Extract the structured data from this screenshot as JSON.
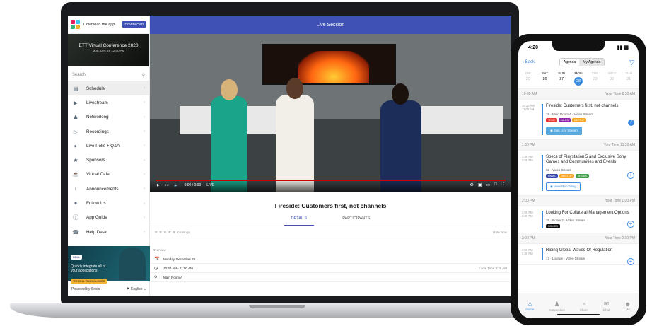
{
  "laptop": {
    "sidebar": {
      "download_text": "Download the app",
      "download_button": "DOWNLOAD",
      "event_title": "ETT Virtual Conference 2020",
      "event_date": "Mon, Dec 28 12:00 AM",
      "search_placeholder": "Search",
      "items": [
        {
          "label": "Schedule",
          "icon": "calendar-icon"
        },
        {
          "label": "Livestream",
          "icon": "video-icon"
        },
        {
          "label": "Networking",
          "icon": "people-icon"
        },
        {
          "label": "Recordings",
          "icon": "play-icon"
        },
        {
          "label": "Live Polls + Q&A",
          "icon": "poll-icon"
        },
        {
          "label": "Sponsors",
          "icon": "trophy-icon"
        },
        {
          "label": "Virtual Cafe",
          "icon": "cafe-icon"
        },
        {
          "label": "Announcements",
          "icon": "megaphone-icon"
        },
        {
          "label": "Follow Us",
          "icon": "twitter-icon"
        },
        {
          "label": "App Guide",
          "icon": "info-icon"
        },
        {
          "label": "Help Desk",
          "icon": "help-icon"
        }
      ],
      "ad": {
        "brand": "DELL",
        "text": "Quickly integrate all of your applications",
        "cta": "TRY DELL TECHNOLOGIES"
      },
      "powered_by": "Powered by Socio",
      "language": "English"
    },
    "topbar_title": "Live Session",
    "video": {
      "time": "0:00 / 0:00",
      "live_label": "LIVE"
    },
    "session": {
      "title": "Fireside: Customers first, not channels",
      "tabs": [
        "DETAILS",
        "PARTICIPANTS"
      ],
      "ratings_text": "0 ratings",
      "rate_now": "Rate Now",
      "overview_label": "Overview",
      "date": "Monday, December 28",
      "time": "10:30 AM - 11:00 AM",
      "local_time": "Local Time 8:30 AM",
      "location": "Main Room A"
    }
  },
  "phone": {
    "status_time": "4:20",
    "back_label": "Back",
    "segments": [
      "Agenda",
      "My Agenda"
    ],
    "days": [
      {
        "name": "FRI",
        "num": "25"
      },
      {
        "name": "SAT",
        "num": "26"
      },
      {
        "name": "SUN",
        "num": "27"
      },
      {
        "name": "MON",
        "num": "28"
      },
      {
        "name": "TUE",
        "num": "29"
      },
      {
        "name": "WED",
        "num": "30"
      },
      {
        "name": "THU",
        "num": "31"
      }
    ],
    "slots": [
      {
        "time": "10:30 AM",
        "your_time": "Your Time 8:30 AM",
        "session_time": "10:30 AM\n11:00 AM",
        "title": "Fireside: Customers first, not channels",
        "meta": "76 · Main Room A · Video Stream",
        "tags": [
          "TECH",
          "SALES",
          "MEETUP"
        ],
        "button": "Join Live Stream"
      },
      {
        "time": "1:30 PM",
        "your_time": "Your Time 11:30 AM",
        "session_time": "1:30 PM\n2:00 PM",
        "title": "Specs of Playstation 5 and Exclusive Sony Games and Communities and Events",
        "meta": "62 · Video Stream",
        "tags": [
          "PANEL",
          "MEETUP",
          "SHOWS"
        ],
        "button": "View Recording"
      },
      {
        "time": "2:00 PM",
        "your_time": "Your Time 1:00 PM",
        "session_time": "2:00 PM\n2:30 PM",
        "title": "Looking For Collateral Management Options",
        "meta": "76 · Room 2 · Video Stream",
        "tags": [
          "SOLVED"
        ]
      },
      {
        "time": "3:00 PM",
        "your_time": "Your Time 2:00 PM",
        "session_time": "3:00 PM\n3:30 PM",
        "title": "Riding Global Waves Of Regulation",
        "meta": "17 · Lounge · Video Stream",
        "tags": []
      }
    ],
    "tabbar": [
      "Home",
      "Connection",
      "Share",
      "Chat",
      "Me"
    ]
  },
  "colors": {
    "brand_indigo": "#3f51b5",
    "accent_blue": "#3a8be0"
  }
}
